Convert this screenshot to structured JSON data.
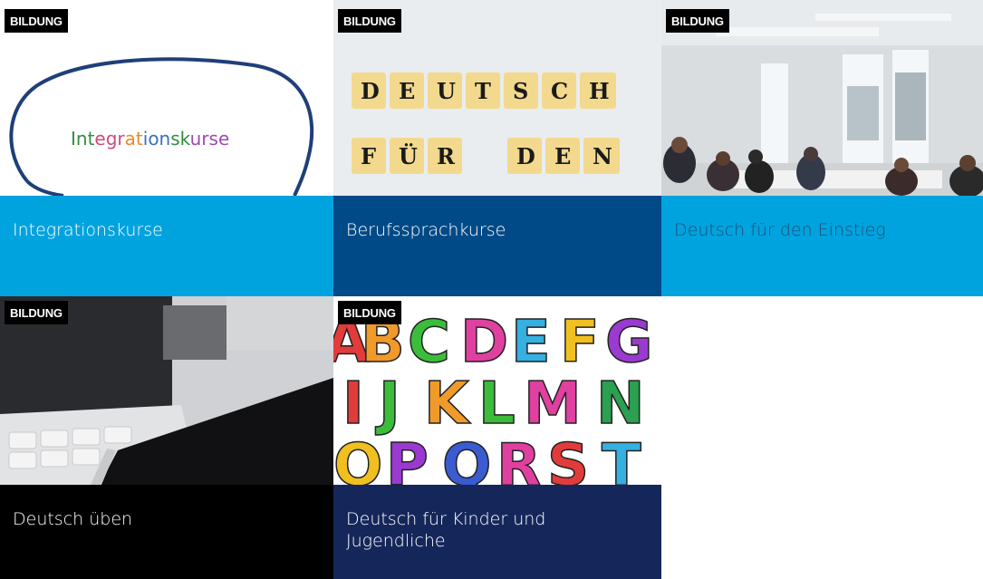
{
  "tiles": [
    {
      "badge": "BILDUNG",
      "title": "Integrationskurse",
      "image_text": "Integrationskurse",
      "color": "#00A3DD"
    },
    {
      "badge": "BILDUNG",
      "title": "Berufssprachkurse",
      "image_text": "DEUTSCH FÜR DEN",
      "color": "#004A87"
    },
    {
      "badge": "BILDUNG",
      "title": "Deutsch für den Einstieg",
      "color": "#00A3DD"
    },
    {
      "badge": "BILDUNG",
      "title": "Deutsch üben",
      "color": "#000000"
    },
    {
      "badge": "BILDUNG",
      "title": "Deutsch für Kinder und Jugendliche",
      "color": "#15275A"
    }
  ]
}
